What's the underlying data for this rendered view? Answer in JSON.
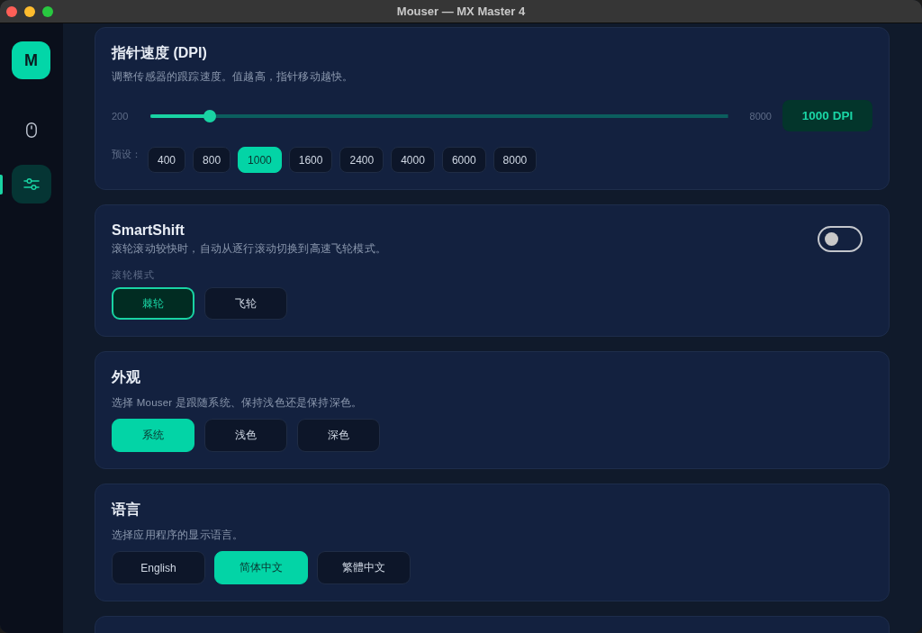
{
  "window": {
    "title": "Mouser — MX Master 4"
  },
  "sidebar": {
    "logo": "M",
    "items": [
      {
        "kind": "device",
        "selected": false
      },
      {
        "kind": "settings",
        "selected": true
      }
    ]
  },
  "dpi": {
    "title": "指针速度 (DPI)",
    "description": "调整传感器的跟踪速度。值越高，指针移动越快。",
    "slider": {
      "min_label": "200",
      "max_label": "8000",
      "level": 0.103
    },
    "value": "1000 DPI",
    "presets_label": "预设：",
    "presets": [
      {
        "label": "400",
        "selected": false
      },
      {
        "label": "800",
        "selected": false
      },
      {
        "label": "1000",
        "selected": true
      },
      {
        "label": "1600",
        "selected": false
      },
      {
        "label": "2400",
        "selected": false
      },
      {
        "label": "4000",
        "selected": false
      },
      {
        "label": "6000",
        "selected": false
      },
      {
        "label": "8000",
        "selected": false
      }
    ]
  },
  "smartshift": {
    "title": "SmartShift",
    "description": "滚轮滚动较快时，自动从逐行滚动切换到高速飞轮模式。",
    "on": false,
    "mode_label": "滚轮模式",
    "modes": [
      {
        "label": "棘轮",
        "selected": true
      },
      {
        "label": "飞轮",
        "selected": false
      }
    ]
  },
  "appearance": {
    "title": "外观",
    "description": "选择 Mouser 是跟随系统、保持浅色还是保持深色。",
    "options": [
      {
        "label": "系统",
        "selected": true
      },
      {
        "label": "浅色",
        "selected": false
      },
      {
        "label": "深色",
        "selected": false
      }
    ]
  },
  "language": {
    "title": "语言",
    "description": "选择应用程序的显示语言。",
    "options": [
      {
        "label": "English",
        "selected": false
      },
      {
        "label": "简体中文",
        "selected": true
      },
      {
        "label": "繁體中文",
        "selected": false
      }
    ]
  }
}
